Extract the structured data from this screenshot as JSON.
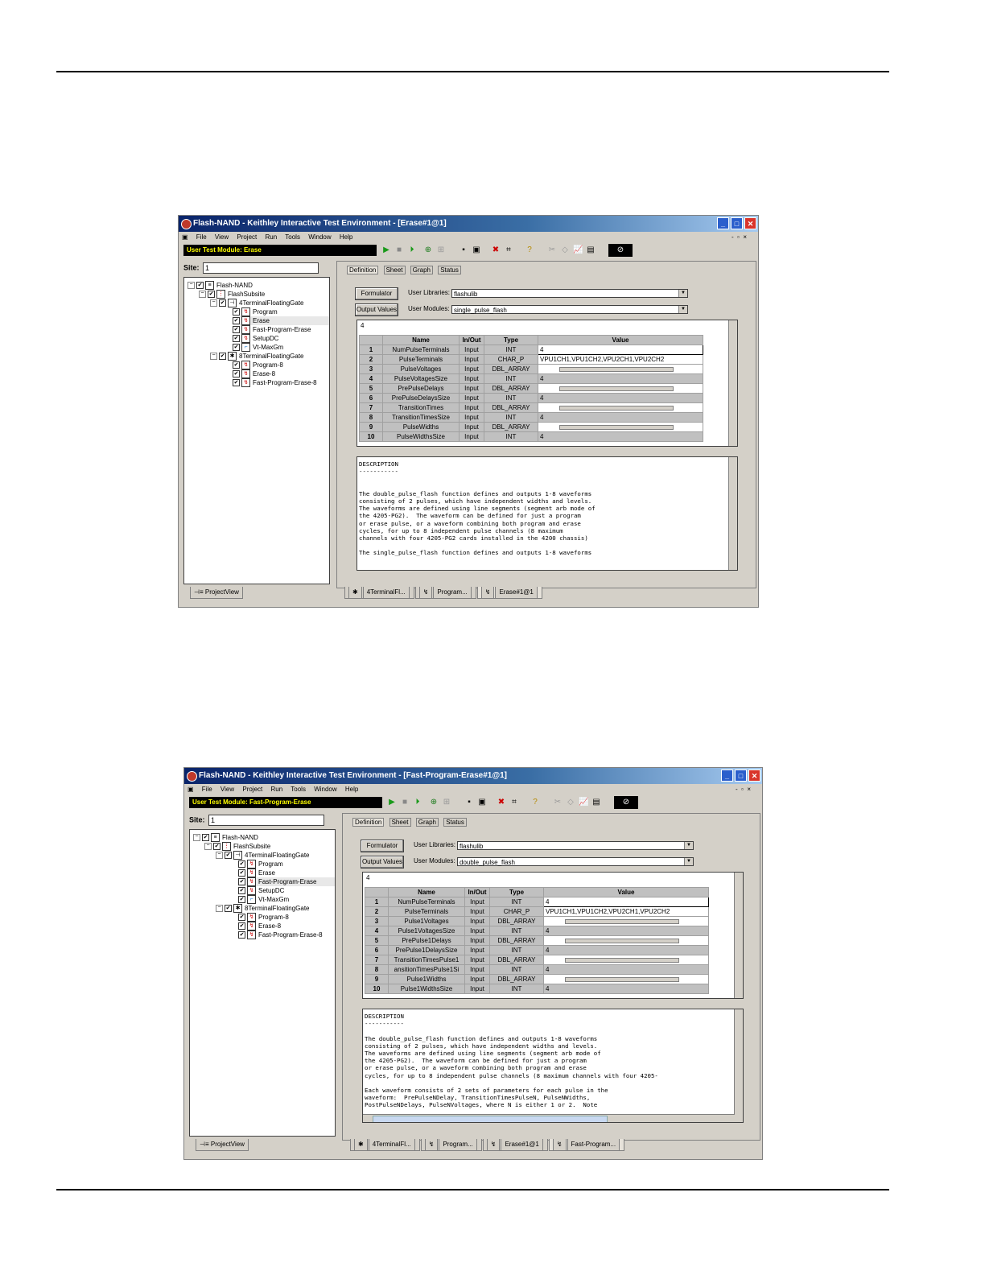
{
  "shot1": {
    "title": "Flash-NAND - Keithley Interactive Test Environment - [Erase#1@1]",
    "menu": [
      "File",
      "View",
      "Project",
      "Run",
      "Tools",
      "Window",
      "Help"
    ],
    "user_test_module": "User Test Module: Erase",
    "site_label": "Site:",
    "site_value": "1",
    "tree": [
      "Flash-NAND",
      "FlashSubsite",
      "4TerminalFloatingGate",
      "Program",
      "Erase",
      "Fast-Program-Erase",
      "SetupDC",
      "Vt-MaxGm",
      "8TerminalFloatingGate",
      "Program-8",
      "Erase-8",
      "Fast-Program-Erase-8"
    ],
    "project_view_tab": "ProjectView",
    "tabs": [
      "Definition",
      "Sheet",
      "Graph",
      "Status"
    ],
    "formulator_btn": "Formulator",
    "output_values_btn": "Output Values",
    "user_libraries_label": "User Libraries:",
    "user_libraries_value": "flashulib",
    "user_modules_label": "User Modules:",
    "user_modules_value": "single_pulse_flash",
    "edit_value": "4",
    "columns": [
      "Name",
      "In/Out",
      "Type",
      "Value"
    ],
    "rows": [
      {
        "n": "1",
        "name": "NumPulseTerminals",
        "io": "Input",
        "type": "INT",
        "value": "4"
      },
      {
        "n": "2",
        "name": "PulseTerminals",
        "io": "Input",
        "type": "CHAR_P",
        "value": "VPU1CH1,VPU1CH2,VPU2CH1,VPU2CH2"
      },
      {
        "n": "3",
        "name": "PulseVoltages",
        "io": "Input",
        "type": "DBL_ARRAY",
        "value": ""
      },
      {
        "n": "4",
        "name": "PulseVoltagesSize",
        "io": "Input",
        "type": "INT",
        "value": "4"
      },
      {
        "n": "5",
        "name": "PrePulseDelays",
        "io": "Input",
        "type": "DBL_ARRAY",
        "value": ""
      },
      {
        "n": "6",
        "name": "PrePulseDelaysSize",
        "io": "Input",
        "type": "INT",
        "value": "4"
      },
      {
        "n": "7",
        "name": "TransitionTimes",
        "io": "Input",
        "type": "DBL_ARRAY",
        "value": ""
      },
      {
        "n": "8",
        "name": "TransitionTimesSize",
        "io": "Input",
        "type": "INT",
        "value": "4"
      },
      {
        "n": "9",
        "name": "PulseWidths",
        "io": "Input",
        "type": "DBL_ARRAY",
        "value": ""
      },
      {
        "n": "10",
        "name": "PulseWidthsSize",
        "io": "Input",
        "type": "INT",
        "value": "4"
      }
    ],
    "description": "DESCRIPTION\n-----------\n\n\nThe double_pulse_flash function defines and outputs 1-8 waveforms\nconsisting of 2 pulses, which have independent widths and levels.\nThe waveforms are defined using line segments (segment arb mode of\nthe 4205-PG2).  The waveform can be defined for just a program\nor erase pulse, or a waveform combining both program and erase\ncycles, for up to 8 independent pulse channels (8 maximum\nchannels with four 4205-PG2 cards installed in the 4200 chassis)\n\nThe single_pulse_flash function defines and outputs 1-8 waveforms",
    "doc_tabs": [
      "4TerminalFl...",
      "Program...",
      "Erase#1@1"
    ]
  },
  "shot2": {
    "title": "Flash-NAND - Keithley Interactive Test Environment - [Fast-Program-Erase#1@1]",
    "menu": [
      "File",
      "View",
      "Project",
      "Run",
      "Tools",
      "Window",
      "Help"
    ],
    "user_test_module": "User Test Module: Fast-Program-Erase",
    "site_label": "Site:",
    "site_value": "1",
    "tree": [
      "Flash-NAND",
      "FlashSubsite",
      "4TerminalFloatingGate",
      "Program",
      "Erase",
      "Fast-Program-Erase",
      "SetupDC",
      "Vt-MaxGm",
      "8TerminalFloatingGate",
      "Program-8",
      "Erase-8",
      "Fast-Program-Erase-8"
    ],
    "project_view_tab": "ProjectView",
    "tabs": [
      "Definition",
      "Sheet",
      "Graph",
      "Status"
    ],
    "formulator_btn": "Formulator",
    "output_values_btn": "Output Values",
    "user_libraries_label": "User Libraries:",
    "user_libraries_value": "flashulib",
    "user_modules_label": "User Modules:",
    "user_modules_value": "double_pulse_flash",
    "edit_value": "4",
    "columns": [
      "Name",
      "In/Out",
      "Type",
      "Value"
    ],
    "rows": [
      {
        "n": "1",
        "name": "NumPulseTerminals",
        "io": "Input",
        "type": "INT",
        "value": "4"
      },
      {
        "n": "2",
        "name": "PulseTerminals",
        "io": "Input",
        "type": "CHAR_P",
        "value": "VPU1CH1,VPU1CH2,VPU2CH1,VPU2CH2"
      },
      {
        "n": "3",
        "name": "Pulse1Voltages",
        "io": "Input",
        "type": "DBL_ARRAY",
        "value": ""
      },
      {
        "n": "4",
        "name": "Pulse1VoltagesSize",
        "io": "Input",
        "type": "INT",
        "value": "4"
      },
      {
        "n": "5",
        "name": "PrePulse1Delays",
        "io": "Input",
        "type": "DBL_ARRAY",
        "value": ""
      },
      {
        "n": "6",
        "name": "PrePulse1DelaysSize",
        "io": "Input",
        "type": "INT",
        "value": "4"
      },
      {
        "n": "7",
        "name": "TransitionTimesPulse1",
        "io": "Input",
        "type": "DBL_ARRAY",
        "value": ""
      },
      {
        "n": "8",
        "name": "ansitionTimesPulse1Si",
        "io": "Input",
        "type": "INT",
        "value": "4"
      },
      {
        "n": "9",
        "name": "Pulse1Widths",
        "io": "Input",
        "type": "DBL_ARRAY",
        "value": ""
      },
      {
        "n": "10",
        "name": "Pulse1WidthsSize",
        "io": "Input",
        "type": "INT",
        "value": "4"
      }
    ],
    "description": "DESCRIPTION\n-----------\n\nThe double_pulse_flash function defines and outputs 1-8 waveforms\nconsisting of 2 pulses, which have independent widths and levels.\nThe waveforms are defined using line segments (segment arb mode of\nthe 4205-PG2).  The waveform can be defined for just a program\nor erase pulse, or a waveform combining both program and erase\ncycles, for up to 8 independent pulse channels (8 maximum channels with four 4205-\n\nEach waveform consists of 2 sets of parameters for each pulse in the\nwaveform:  PrePulseNDelay, TransitionTimesPulseN, PulseNWidths,\nPostPulseNDelays, PulseNVoltages, where N is either 1 or 2.  Note",
    "doc_tabs": [
      "4TerminalFl...",
      "Program...",
      "Erase#1@1",
      "Fast-Program..."
    ]
  }
}
